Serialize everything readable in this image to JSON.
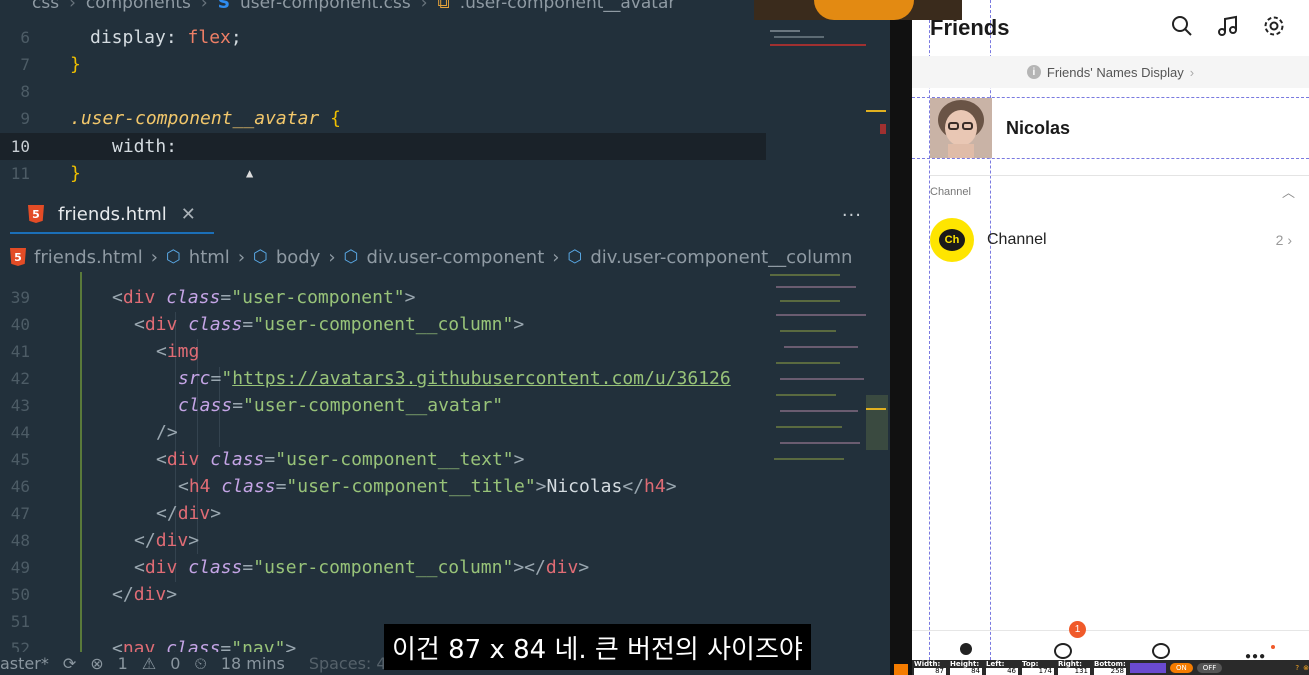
{
  "css_breadcrumb": [
    "css",
    "components",
    "user-component.css",
    ".user-component__avatar"
  ],
  "css_lines": [
    {
      "n": "6",
      "text": "display: flex;"
    },
    {
      "n": "7",
      "text": "}"
    },
    {
      "n": "8",
      "text": ""
    },
    {
      "n": "9",
      "text": ".user-component__avatar {"
    },
    {
      "n": "10",
      "text": "width:"
    },
    {
      "n": "11",
      "text": "}"
    }
  ],
  "html_tab": {
    "file": "friends.html",
    "badge": "5"
  },
  "html_breadcrumb": [
    "friends.html",
    "html",
    "body",
    "div.user-component",
    "div.user-component__column"
  ],
  "html_lines": [
    {
      "n": "39",
      "text": "<div class=\"user-component\">"
    },
    {
      "n": "40",
      "text": "<div class=\"user-component__column\">"
    },
    {
      "n": "41",
      "text": "<img"
    },
    {
      "n": "42",
      "text": "src=\"https://avatars3.githubusercontent.com/u/36126"
    },
    {
      "n": "43",
      "text": "class=\"user-component__avatar\""
    },
    {
      "n": "44",
      "text": "/>"
    },
    {
      "n": "45",
      "text": "<div class=\"user-component__text\">"
    },
    {
      "n": "46",
      "text": "<h4 class=\"user-component__title\">Nicolas</h4>"
    },
    {
      "n": "47",
      "text": "</div>"
    },
    {
      "n": "48",
      "text": "</div>"
    },
    {
      "n": "49",
      "text": "<div class=\"user-component__column\"></div>"
    },
    {
      "n": "50",
      "text": "</div>"
    },
    {
      "n": "51",
      "text": ""
    },
    {
      "n": "52",
      "text": "<nav class=\"nav\">"
    }
  ],
  "status": {
    "branch": "aster*",
    "problems": "1",
    "warnings": "0",
    "time": "18 mins",
    "faded": "Spaces: 4   UTF-8   LF   CSS   Prettier"
  },
  "subtitle": "이건 87 x 84 네. 큰 버전의 사이즈야",
  "app": {
    "title": "Friends",
    "notice": "Friends' Names Display",
    "user_name": "Nicolas",
    "section_label": "Channel",
    "channel_name": "Channel",
    "channel_count": "2",
    "channel_logo": "Ch",
    "chat_badge": "1",
    "icons": [
      "search-icon",
      "music-icon",
      "settings-icon"
    ]
  },
  "devtools": {
    "width_label": "Width:",
    "width_val": "87",
    "height_label": "Height:",
    "height_val": "84",
    "left_label": "Left:",
    "left_val": "46",
    "top_label": "Top:",
    "top_val": "174",
    "right_label": "Right:",
    "right_val": "131",
    "bottom_label": "Bottom:",
    "bottom_val": "258",
    "on": "ON",
    "off": "OFF"
  },
  "colors": {
    "editor_bg": "#22303b",
    "kakao_yellow": "#fee500",
    "badge_orange": "#f05a2a"
  }
}
